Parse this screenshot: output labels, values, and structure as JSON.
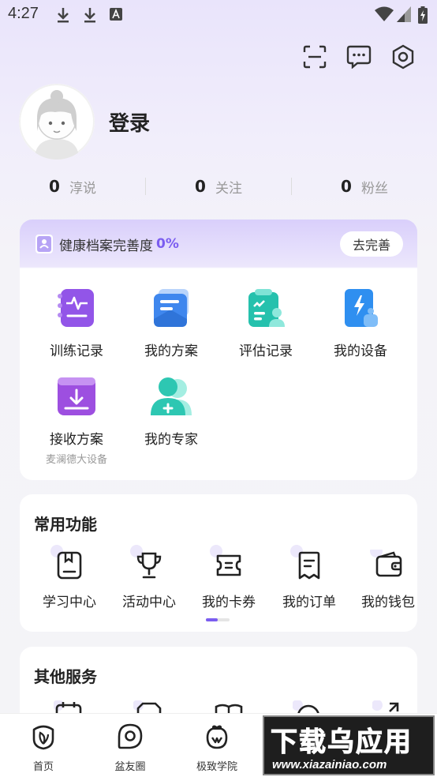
{
  "status_bar": {
    "time": "4:27"
  },
  "profile": {
    "login_label": "登录"
  },
  "stats": [
    {
      "count": "0",
      "label": "淳说"
    },
    {
      "count": "0",
      "label": "关注"
    },
    {
      "count": "0",
      "label": "粉丝"
    }
  ],
  "health": {
    "title": "健康档案完善度",
    "percent": "0%",
    "action_label": "去完善",
    "items": [
      {
        "label": "训练记录",
        "icon": "training-record-icon"
      },
      {
        "label": "我的方案",
        "icon": "my-plan-icon"
      },
      {
        "label": "评估记录",
        "icon": "assessment-record-icon"
      },
      {
        "label": "我的设备",
        "icon": "my-device-icon"
      },
      {
        "label": "接收方案",
        "sublabel": "麦澜德大设备",
        "icon": "receive-plan-icon"
      },
      {
        "label": "我的专家",
        "icon": "my-expert-icon"
      }
    ]
  },
  "common_functions": {
    "title": "常用功能",
    "items": [
      {
        "label": "学习中心",
        "icon": "book-icon"
      },
      {
        "label": "活动中心",
        "icon": "trophy-icon"
      },
      {
        "label": "我的卡券",
        "icon": "coupon-icon"
      },
      {
        "label": "我的订单",
        "icon": "receipt-icon"
      },
      {
        "label": "我的钱包",
        "icon": "wallet-icon"
      }
    ]
  },
  "other_services": {
    "title": "其他服务"
  },
  "tabbar": [
    {
      "label": "首页",
      "icon": "home-leaf-icon"
    },
    {
      "label": "盆友圈",
      "icon": "circle-icon"
    },
    {
      "label": "极致学院",
      "icon": "academy-icon"
    }
  ],
  "watermark": {
    "big": "下载乌应用",
    "small": "www.xiazainiao.com"
  },
  "colors": {
    "accent": "#7b5df0",
    "purple": "#8b54e8",
    "blue": "#3f8df2",
    "teal": "#2ec7b4"
  }
}
